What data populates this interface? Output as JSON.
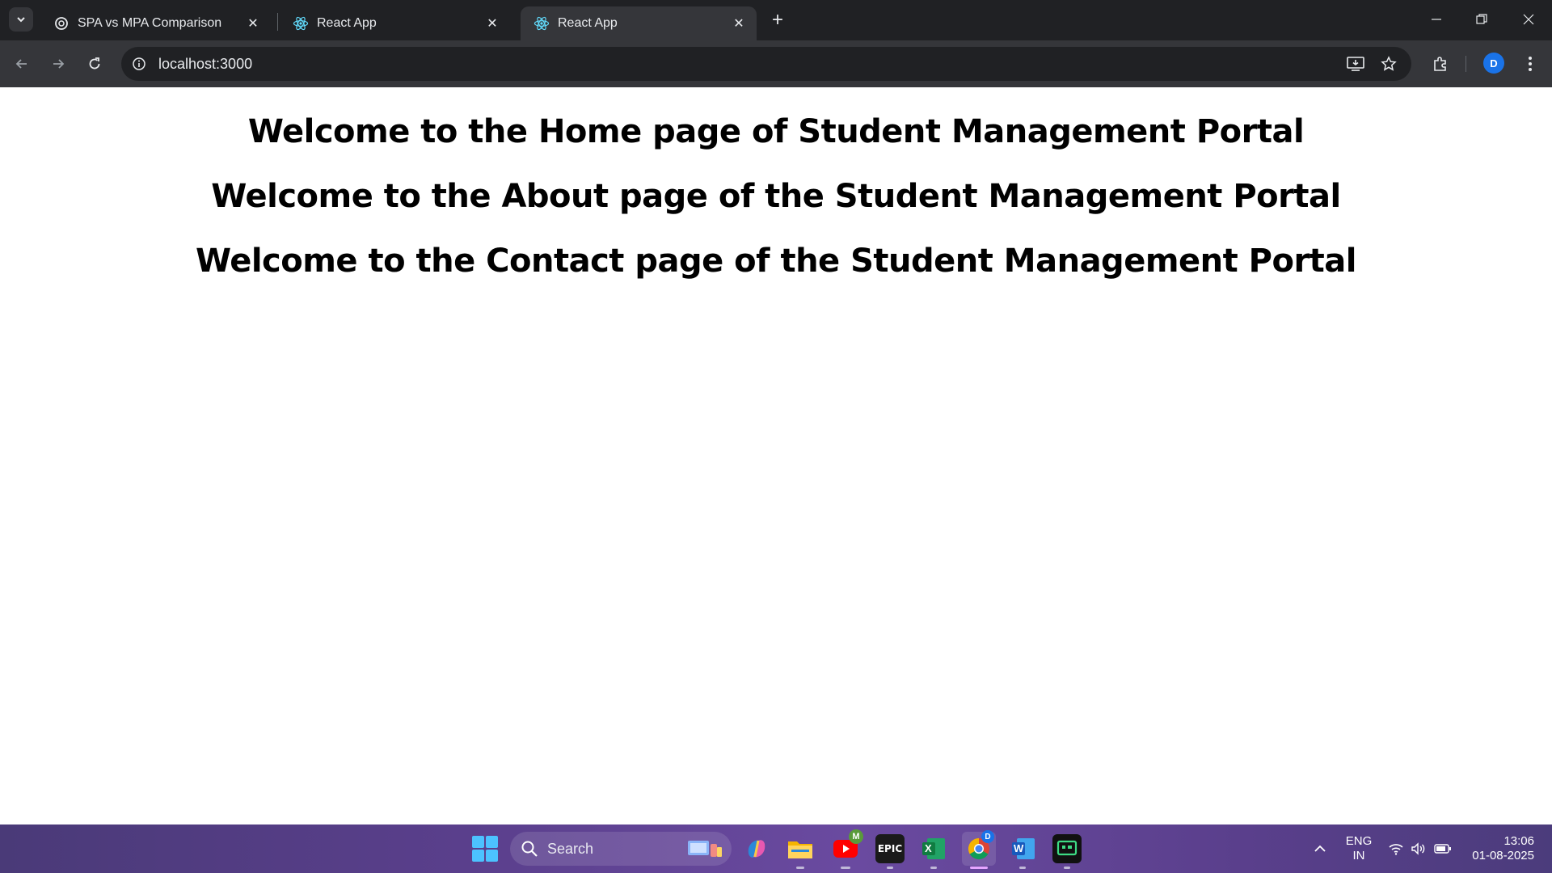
{
  "browser": {
    "tabs": [
      {
        "title": "SPA vs MPA Comparison",
        "favicon": "openai-icon",
        "active": false
      },
      {
        "title": "React App",
        "favicon": "react-icon",
        "active": false
      },
      {
        "title": "React App",
        "favicon": "react-icon",
        "active": true
      }
    ],
    "address": "localhost:3000",
    "profile_initial": "D",
    "accent_color": "#1a73e8"
  },
  "page": {
    "headings": [
      "Welcome to the Home page of Student Management Portal",
      "Welcome to the About page of the Student Management Portal",
      "Welcome to the Contact page of the Student Management Portal"
    ]
  },
  "taskbar": {
    "search_label": "Search",
    "apps": [
      "copilot-icon",
      "file-explorer-icon",
      "youtube-icon",
      "epic-games-icon",
      "excel-icon",
      "chrome-icon",
      "word-icon",
      "terminal-icon"
    ],
    "youtube_badge": "M",
    "chrome_badge": "D",
    "epic_label": "EPIC",
    "excel_letter": "X",
    "word_letter": "W",
    "language": "ENG",
    "region": "IN",
    "time": "13:06",
    "date": "01-08-2025"
  }
}
